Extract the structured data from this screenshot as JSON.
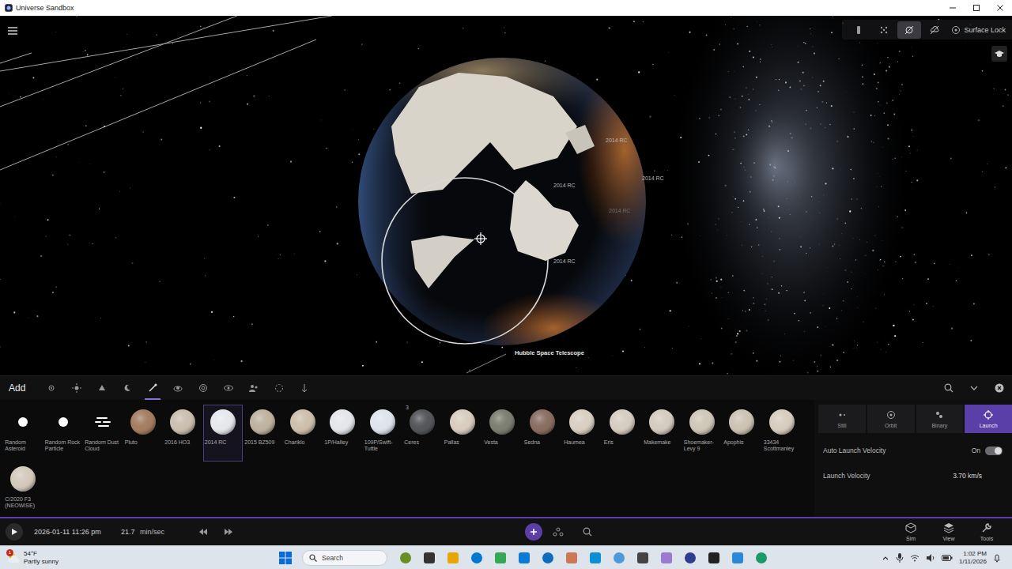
{
  "window": {
    "title": "Universe Sandbox"
  },
  "viewport": {
    "labels": [
      {
        "text": "2014 RC",
        "dim": false
      },
      {
        "text": "2014 RC",
        "dim": false
      },
      {
        "text": "2014 RC",
        "dim": false
      },
      {
        "text": "2014 RC",
        "dim": true
      },
      {
        "text": "2014 RC",
        "dim": false
      }
    ],
    "telescope_label": "Hubble Space Telescope",
    "toolbar": [
      {
        "selected": false
      },
      {
        "selected": false
      },
      {
        "selected": true
      },
      {
        "selected": false
      }
    ],
    "surface_lock": {
      "label": "Surface Lock"
    }
  },
  "add_panel": {
    "title": "Add",
    "categories": [
      {
        "selected": false
      },
      {
        "selected": false
      },
      {
        "selected": false
      },
      {
        "selected": false
      },
      {
        "selected": true
      },
      {
        "selected": false
      },
      {
        "selected": false
      },
      {
        "selected": false
      },
      {
        "selected": false
      },
      {
        "selected": false
      },
      {
        "selected": false
      }
    ],
    "items": [
      {
        "label": "Random Asteroid",
        "kind": "dot",
        "selected": false,
        "color": "#ffffff"
      },
      {
        "label": "Random Rock Particle",
        "kind": "dot",
        "selected": false,
        "color": "#ffffff"
      },
      {
        "label": "Random Dust Cloud",
        "kind": "cloud",
        "selected": false,
        "color": "#ffffff"
      },
      {
        "label": "Pluto",
        "kind": "body",
        "selected": false,
        "color": "#a47e62"
      },
      {
        "label": "2016 HO3",
        "kind": "body",
        "selected": false,
        "color": "#cbbfae"
      },
      {
        "label": "2014 RC",
        "kind": "body",
        "selected": true,
        "color": "#e6e8ec"
      },
      {
        "label": "2015 BZ509",
        "kind": "body",
        "selected": false,
        "color": "#bfb3a0"
      },
      {
        "label": "Chariklo",
        "kind": "body",
        "selected": false,
        "color": "#cdbfab"
      },
      {
        "label": "1P/Halley",
        "kind": "body",
        "selected": false,
        "color": "#e4e6ea"
      },
      {
        "label": "109P/Swift-Tuttle",
        "kind": "body",
        "selected": false,
        "color": "#dfe4ec"
      },
      {
        "label": "Ceres",
        "kind": "body",
        "selected": false,
        "color": "#55575a",
        "badge": "3"
      },
      {
        "label": "Pallas",
        "kind": "body",
        "selected": false,
        "color": "#d8cdbf"
      },
      {
        "label": "Vesta",
        "kind": "body",
        "selected": false,
        "color": "#7d7f72"
      },
      {
        "label": "Sedna",
        "kind": "body",
        "selected": false,
        "color": "#8a6e62"
      },
      {
        "label": "Haumea",
        "kind": "body",
        "selected": false,
        "color": "#d9cfc2"
      },
      {
        "label": "Eris",
        "kind": "body",
        "selected": false,
        "color": "#d6ccc0"
      },
      {
        "label": "Makemake",
        "kind": "body",
        "selected": false,
        "color": "#d5cbbf"
      },
      {
        "label": "Shoemaker-Levy 9",
        "kind": "body",
        "selected": false,
        "color": "#cfc7b8"
      },
      {
        "label": "Apophis",
        "kind": "body",
        "selected": false,
        "color": "#cdc3b4"
      },
      {
        "label": "33434 Scottmanley",
        "kind": "body",
        "selected": false,
        "color": "#d7cdbf"
      },
      {
        "label": "C/2020 F3 (NEOWISE)",
        "kind": "body",
        "selected": false,
        "color": "#d4cabc"
      }
    ],
    "modes": [
      {
        "label": "Still",
        "selected": false
      },
      {
        "label": "Orbit",
        "selected": false
      },
      {
        "label": "Binary",
        "selected": false
      },
      {
        "label": "Launch",
        "selected": true
      }
    ],
    "auto_launch": {
      "label": "Auto Launch Velocity",
      "value": "On",
      "on": true
    },
    "launch_velocity": {
      "label": "Launch Velocity",
      "value": "3.70 km/s"
    }
  },
  "sim_bar": {
    "date": "2026-01-11 11:26 pm",
    "speed": "21.7",
    "speed_unit": "min/sec",
    "playing": false,
    "menus": [
      {
        "label": "Sim"
      },
      {
        "label": "View"
      },
      {
        "label": "Tools"
      }
    ]
  },
  "taskbar": {
    "temperature": "54°F",
    "weather": "Partly sunny",
    "alert": "1",
    "search": "Search",
    "time": "1:02 PM",
    "date": "1/11/2026"
  }
}
